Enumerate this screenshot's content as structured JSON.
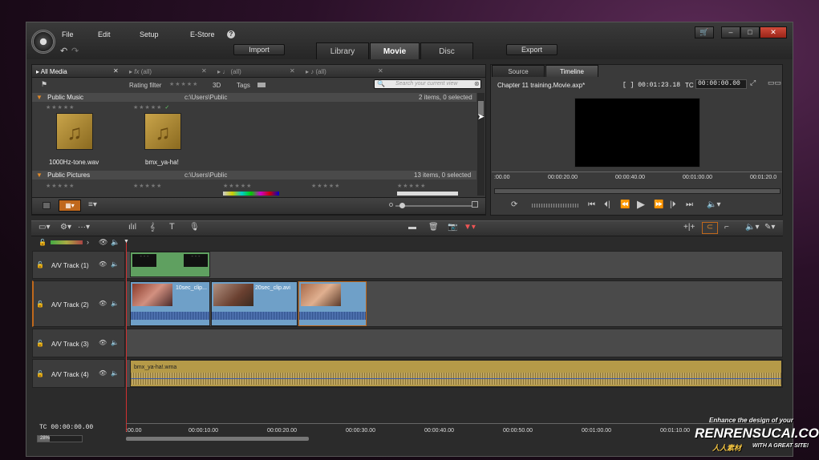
{
  "menu": {
    "file": "File",
    "edit": "Edit",
    "setup": "Setup",
    "estore": "E-Store",
    "help": "?"
  },
  "toolbar": {
    "import": "Import",
    "export": "Export"
  },
  "tabs": {
    "library": "Library",
    "movie": "Movie",
    "disc": "Disc"
  },
  "library": {
    "all_media": "All Media",
    "filters": [
      "(all)",
      "(all)",
      "(all)"
    ],
    "rating_filter": "Rating filter",
    "three_d": "3D",
    "tags": "Tags",
    "search_placeholder": "Search your current view",
    "sections": [
      {
        "name": "Public Music",
        "path": "c:\\Users\\Public",
        "count": "2 items, 0 selected"
      },
      {
        "name": "Public Pictures",
        "path": "c:\\Users\\Public",
        "count": "13 items, 0 selected"
      }
    ],
    "items": [
      {
        "label": "1000Hz-tone.wav"
      },
      {
        "label": "bmx_ya-ha!"
      }
    ]
  },
  "player": {
    "source_tab": "Source",
    "timeline_tab": "Timeline",
    "title": "Chapter 11 training.Movie.axp*",
    "duration": "[ ] 00:01:23.18",
    "tc_label": "TC",
    "tc_value": "00:00:00.00",
    "ruler": [
      ":00.00",
      "00:00:20.00",
      "00:00:40.00",
      "00:01:00.00",
      "00:01:20.0"
    ]
  },
  "timeline": {
    "tracks": [
      {
        "label": "A/V Track (1)"
      },
      {
        "label": "A/V Track (2)"
      },
      {
        "label": "A/V Track (3)"
      },
      {
        "label": "A/V Track (4)"
      }
    ],
    "clips": {
      "clip1": "10sec_clip...",
      "clip2": "20sec_clip.avi",
      "audio": "bmx_ya-ha!.wma"
    },
    "tc_label": "TC",
    "tc_value": "00:00:00.00",
    "zoom": "28%",
    "zoom_fraction": 0.28,
    "ruler": [
      ":00.00",
      "00:00:10.00",
      "00:00:20.00",
      "00:00:30.00",
      "00:00:40.00",
      "00:00:50.00",
      "00:01:00.00",
      "00:01:10.00"
    ]
  },
  "watermark": {
    "line1": "Enhance the design of your",
    "brand": "RENRENSUCAI.COM",
    "line3": "WITH A GREAT SITE!",
    "cn": "人人素材"
  }
}
